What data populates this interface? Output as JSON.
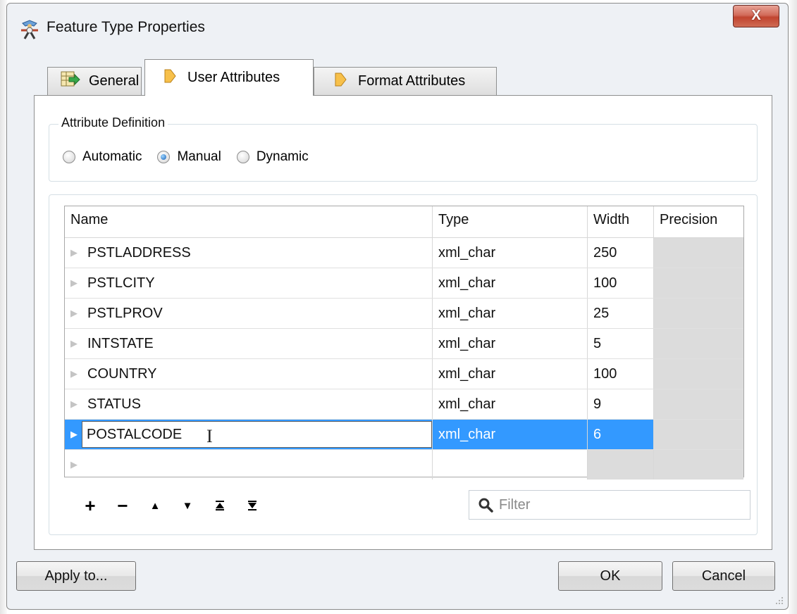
{
  "window": {
    "title": "Feature Type Properties",
    "close_label": "X"
  },
  "tabs": [
    {
      "label": "General",
      "icon": "table-arrow-icon",
      "active": false
    },
    {
      "label": "User Attributes",
      "icon": "diamond-arrow-icon",
      "active": true
    },
    {
      "label": "Format Attributes",
      "icon": "diamond-arrow-icon",
      "active": false
    }
  ],
  "attribute_definition": {
    "title": "Attribute Definition",
    "options": [
      "Automatic",
      "Manual",
      "Dynamic"
    ],
    "selected": "Manual"
  },
  "table": {
    "columns": [
      "Name",
      "Type",
      "Width",
      "Precision"
    ],
    "rows": [
      {
        "name": "PSTLADDRESS",
        "type": "xml_char",
        "width": "250",
        "precision": ""
      },
      {
        "name": "PSTLCITY",
        "type": "xml_char",
        "width": "100",
        "precision": ""
      },
      {
        "name": "PSTLPROV",
        "type": "xml_char",
        "width": "25",
        "precision": ""
      },
      {
        "name": "INTSTATE",
        "type": "xml_char",
        "width": "5",
        "precision": ""
      },
      {
        "name": "COUNTRY",
        "type": "xml_char",
        "width": "100",
        "precision": ""
      },
      {
        "name": "STATUS",
        "type": "xml_char",
        "width": "9",
        "precision": ""
      },
      {
        "name": "POSTALCODE",
        "type": "xml_char",
        "width": "6",
        "precision": ""
      }
    ],
    "selected_row": 6
  },
  "toolbar": {
    "add": "+",
    "remove": "−",
    "move_up": "▲",
    "move_down": "▼",
    "move_top": "⏶",
    "move_bottom": "⏷"
  },
  "filter": {
    "placeholder": "Filter",
    "icon": "search-icon"
  },
  "buttons": {
    "apply": "Apply to...",
    "ok": "OK",
    "cancel": "Cancel"
  },
  "colors": {
    "selection": "#3399ff",
    "close_button": "#c1442f",
    "disabled_cell": "#dcdcdc"
  }
}
